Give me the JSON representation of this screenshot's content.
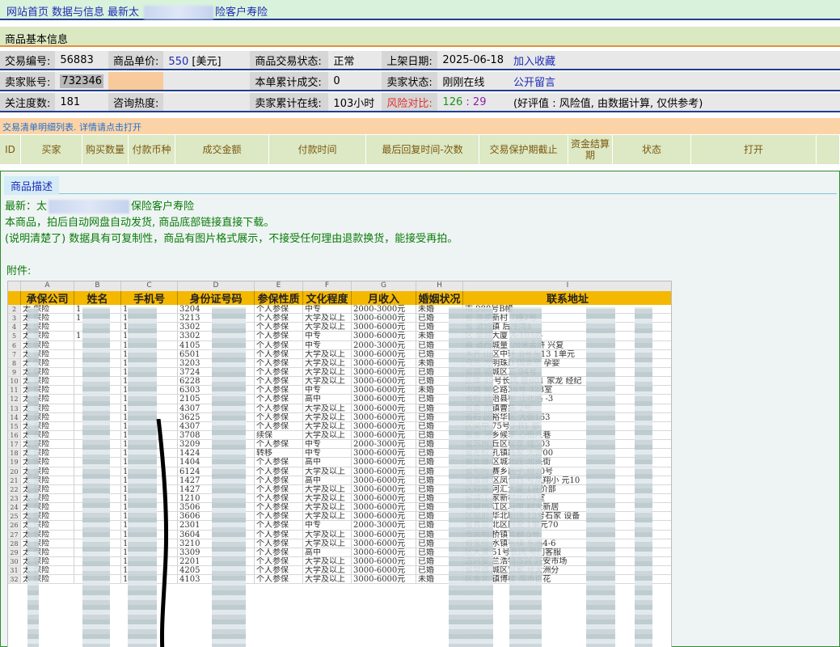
{
  "nav": {
    "home": "网站首页",
    "data_info": "数据与信息",
    "title_prefix": "最新太",
    "title_suffix": "险客户寿险"
  },
  "basic": {
    "section_title": "商品基本信息",
    "row1": {
      "tx_id_label": "交易编号:",
      "tx_id": "56883",
      "price_label": "商品单价:",
      "price": "550",
      "price_unit": "[美元]",
      "status_label": "商品交易状态:",
      "status": "正常",
      "date_label": "上架日期:",
      "date": "2025-06-18",
      "fav": "加入收藏"
    },
    "row2": {
      "seller_label": "卖家账号:",
      "seller": "732346",
      "sold_label": "本单累计成交:",
      "sold": "0",
      "seller_status_label": "卖家状态:",
      "seller_status": "刚刚在线",
      "message": "公开留言"
    },
    "row3": {
      "follow_label": "关注度数:",
      "follow": "181",
      "heat_label": "咨询热度:",
      "online_label": "卖家累计在线:",
      "online": "103小时",
      "risk_label": "风险对比:",
      "risk_good": "126",
      "risk_sep": ":",
      "risk_bad": "29",
      "risk_note": "(好评值 : 风险值, 由数据计算, 仅供参考)"
    }
  },
  "transactions": {
    "caption": "交易清单明细列表. 详情请点击打开",
    "columns": [
      "ID",
      "买家",
      "购买数量",
      "付款币种",
      "成交金额",
      "付款时间",
      "最后回复时间-次数",
      "交易保护期截止",
      "资金结算期",
      "状态",
      "打开"
    ]
  },
  "description": {
    "title": "商品描述",
    "line1_prefix": "最新：太",
    "line1_suffix": "保险客户寿险",
    "line2": "本商品，拍后自动网盘自动发货, 商品底部链接直接下载。",
    "line3": "(说明清楚了) 数据具有可复制性，商品有图片格式展示，不接受任何理由退款换货，能接受再拍。",
    "attachment": "附件:"
  },
  "sheet": {
    "col_letters": [
      "",
      "A",
      "B",
      "C",
      "D",
      "E",
      "F",
      "G",
      "H",
      "I"
    ],
    "headers": [
      "",
      "承保公司",
      "姓名",
      "手机号",
      "身份证号码",
      "参保性质",
      "文化程度",
      "月收入",
      "婚姻状况",
      "联系地址"
    ],
    "rows": [
      [
        "2",
        "太",
        "1",
        "1",
        "3204",
        "个人参保",
        "中专",
        "2000-3000元",
        "未婚",
        "市",
        "988号B幢"
      ],
      [
        "3",
        "太",
        "1",
        "1",
        "3213",
        "个人参保",
        "大学及以上",
        "3000-6000元",
        "已婚",
        "省",
        "渔婆新村",
        "7幢2号"
      ],
      [
        "4",
        "太",
        "",
        "1",
        "3302",
        "个人参保",
        "大学及以上",
        "3000-6000元",
        "已婚",
        "省",
        "道城镇",
        "后冷湾4"
      ],
      [
        "5",
        "太",
        "1",
        "1",
        "3302",
        "个人参保",
        "中专",
        "3000-6000元",
        "未婚",
        "区",
        "皇城大厦",
        "A-103办"
      ],
      [
        "6",
        "太",
        "",
        "1",
        "4105",
        "个人参保",
        "中专",
        "2000-3000元",
        "已婚",
        "县",
        "道西城量",
        "20米孟浒",
        "兴复"
      ],
      [
        "7",
        "太",
        "",
        "1",
        "6501",
        "个人参保",
        "大学及以上",
        "3000-6000元",
        "已婚",
        "木齐",
        "山区中环",
        "B号东13",
        "1单元"
      ],
      [
        "8",
        "太",
        "",
        "1",
        "3203",
        "个人参保",
        "大学及以上",
        "3000-6000元",
        "未婚",
        "乌兰",
        "方明珠D",
        "国耍奈",
        "孕婴"
      ],
      [
        "9",
        "太",
        "",
        "1",
        "3724",
        "个人参保",
        "大学及以上",
        "3000-6000元",
        "已婚",
        "省德",
        "德城区三",
        "94号"
      ],
      [
        "10",
        "太",
        "",
        "1",
        "6228",
        "个人参保",
        "大学及以上",
        "3000-6000元",
        "已婚",
        "区体",
        "49号长风",
        "座601",
        "家龙",
        "经纪"
      ],
      [
        "11",
        "太",
        "",
        "1",
        "6303",
        "个人参保",
        "中专",
        "3000-6000元",
        "未婚",
        "市城",
        "昆仑路26号",
        "323室"
      ],
      [
        "12",
        "太",
        "",
        "1",
        "2105",
        "个人参保",
        "高中",
        "3000-6000元",
        "已婚",
        "省桓",
        "自治县柜",
        "江北路",
        "-3"
      ],
      [
        "13",
        "太",
        "",
        "1",
        "4307",
        "个人参保",
        "大学及以上",
        "3000-6000元",
        "已婚",
        "省鱼",
        "阁镇曹集",
        "2号"
      ],
      [
        "14",
        "太",
        "",
        "1",
        "3625",
        "个人参保",
        "大学及以上",
        "3000-6000元",
        "已婚",
        "省石",
        "区裕华区",
        "大街163"
      ],
      [
        "15",
        "太",
        "",
        "1",
        "4307",
        "个人参保",
        "大学及以上",
        "3000-6000元",
        "已婚",
        "区吴中",
        "75号2-B1",
        "部"
      ],
      [
        "16",
        "太",
        "",
        "1",
        "3708",
        "续保",
        "大学及以上",
        "3000-6000元",
        "已婚",
        "省金",
        "河乡候李",
        "心街八巷"
      ],
      [
        "17",
        "太",
        "",
        "1",
        "3209",
        "个人参保",
        "中专",
        "2000-3000元",
        "已婚",
        "省苏州",
        "丘区馨泰",
        "幢503"
      ],
      [
        "18",
        "太",
        "",
        "1",
        "1424",
        "转移",
        "中专",
        "3000-6000元",
        "已婚",
        "省左权",
        "孔镇路家",
        "大街00"
      ],
      [
        "19",
        "太",
        "",
        "1",
        "1404",
        "个人参保",
        "高中",
        "3000-6000元",
        "已婚",
        "省长治",
        "区城北庄",
        "北头街"
      ],
      [
        "20",
        "太",
        "",
        "1",
        "6124",
        "个人参保",
        "大学及以上",
        "3000-6000元",
        "已婚",
        "省旬阳",
        "赛乡庙子",
        "组20号"
      ],
      [
        "21",
        "太",
        "",
        "1",
        "1427",
        "个人参保",
        "高中",
        "3000-6000元",
        "已婚",
        "省晋城",
        "区凤台西",
        "号凤翔小",
        "元10"
      ],
      [
        "22",
        "太",
        "",
        "1",
        "1427",
        "个人参保",
        "大学及以上",
        "3000-6000元",
        "已婚",
        "区双塔",
        "河汇大厦",
        "1评价部"
      ],
      [
        "23",
        "太",
        "",
        "1",
        "1210",
        "个人参保",
        "大学及以上",
        "3000-6000元",
        "已婚",
        "省靖江",
        "家新村北",
        "04室"
      ],
      [
        "24",
        "太",
        "",
        "1",
        "3506",
        "个人参保",
        "大学及以上",
        "3000-6000元",
        "已婚",
        "省泉州",
        "江区马甲",
        "村大新居"
      ],
      [
        "25",
        "太",
        "",
        "1",
        "3606",
        "个人参保",
        "大学及以上",
        "3000-6000元",
        "已婚",
        "区站前",
        "华北眼镜",
        "12号石家",
        "设备"
      ],
      [
        "26",
        "太",
        "",
        "1",
        "2301",
        "个人参保",
        "中专",
        "2000-3000元",
        "已婚",
        "省青岛",
        "北区同安",
        "1单元70"
      ],
      [
        "27",
        "太",
        "",
        "1",
        "3604",
        "个人参保",
        "大学及以上",
        "3000-6000元",
        "已婚",
        "市崇明",
        "桥镇育麟",
        "5号"
      ],
      [
        "28",
        "太",
        "",
        "1",
        "3210",
        "个人参保",
        "大学及以上",
        "3000-6000元",
        "已婚",
        "省宝应",
        "水镇韦镇",
        "东路4-6"
      ],
      [
        "29",
        "太",
        "",
        "1",
        "3309",
        "个人参保",
        "高中",
        "3000-6000元",
        "已婚",
        "区大渡",
        "51号长风",
        "号门客服"
      ],
      [
        "30",
        "太",
        "",
        "1",
        "2201",
        "个人参保",
        "大学及以上",
        "3000-6000元",
        "已婚",
        "古兴安",
        "兰浩特市兴",
        "兴安市场"
      ],
      [
        "31",
        "太",
        "",
        "1",
        "4205",
        "个人参保",
        "大学及以上",
        "3000-6000元",
        "已婚",
        "省常德",
        "城区贸家",
        "号大洲分"
      ],
      [
        "32",
        "太",
        "",
        "1",
        "4103",
        "个人参保",
        "大学及以上",
        "3000-6000元",
        "未婚",
        "区金北",
        "镇博楼",
        "南市百花"
      ]
    ]
  }
}
